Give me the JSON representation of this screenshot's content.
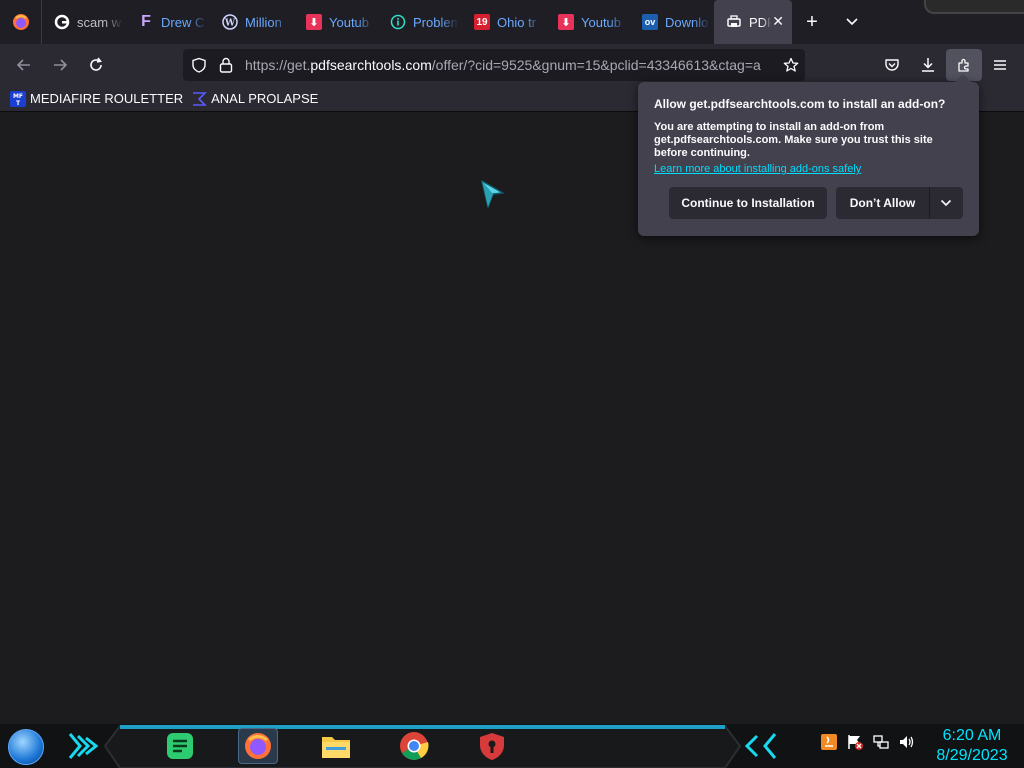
{
  "browser": {
    "tabs": [
      {
        "title": "scam w",
        "favicon": "google-icon"
      },
      {
        "title": "Drew C",
        "favicon": "f-icon"
      },
      {
        "title": "Million",
        "favicon": "wordpress-icon"
      },
      {
        "title": "Youtub",
        "favicon": "download-icon"
      },
      {
        "title": "Problem",
        "favicon": "info-icon"
      },
      {
        "title": "Ohio tr",
        "favicon": "news19-icon"
      },
      {
        "title": "Youtub",
        "favicon": "download-icon"
      },
      {
        "title": "Downlo",
        "favicon": "ov-icon"
      },
      {
        "title": "PDF",
        "favicon": "printer-icon",
        "active": true
      }
    ],
    "url_prefix": "https://get.",
    "url_domain": "pdfsearchtools.com",
    "url_suffix": "/offer/?cid=9525&gnum=15&pclid=43346613&ctag=a",
    "bookmarks": [
      {
        "label": "MEDIAFIRE ROULETTER",
        "icon": "mediafire-icon"
      },
      {
        "label": "ANAL PROLAPSE",
        "icon": "sigma-icon"
      }
    ]
  },
  "popup": {
    "heading": "Allow get.pdfsearchtools.com to install an add-on?",
    "body": "You are attempting to install an add-on from get.pdfsearchtools.com. Make sure you trust this site before continuing.",
    "link": "Learn more about installing add-ons safely",
    "continue_label": "Continue to Installation",
    "deny_label": "Don’t Allow"
  },
  "taskbar": {
    "time": "6:20 AM",
    "date": "8/29/2023"
  },
  "colors": {
    "accent": "#00ddff",
    "popup_bg": "#42414d",
    "toolbar_bg": "#2b2a33"
  }
}
